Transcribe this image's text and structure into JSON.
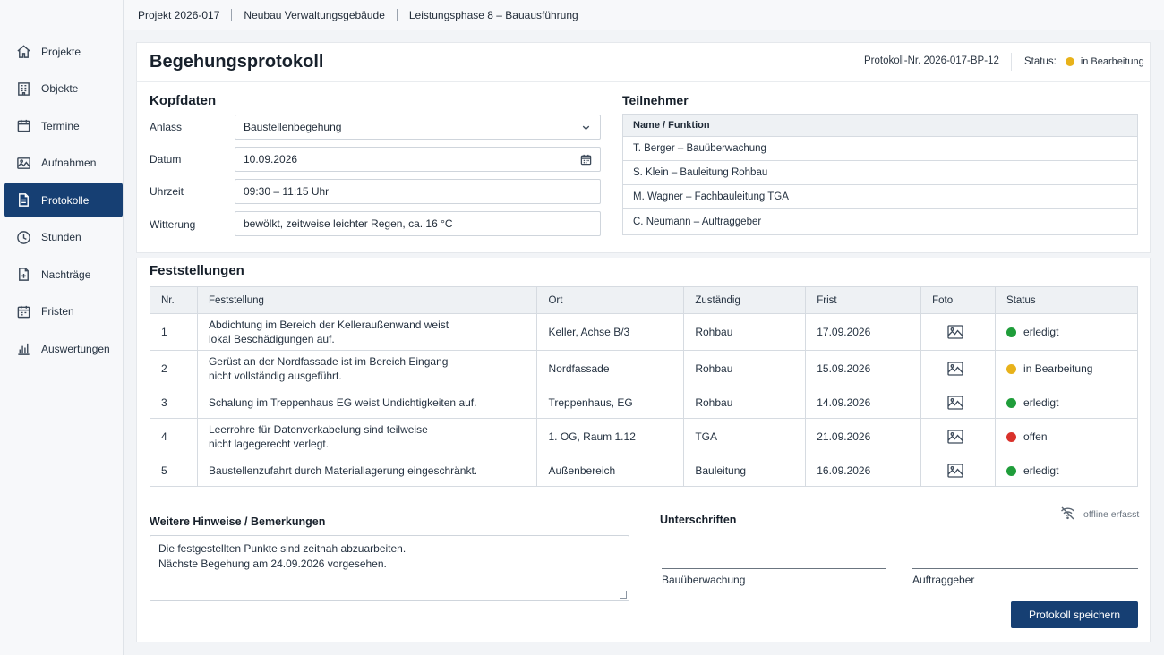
{
  "breadcrumb": [
    "Projekt 2026-017",
    "Neubau Verwaltungsgebäude",
    "Leistungsphase 8 – Bauausführung"
  ],
  "sidebar": {
    "items": [
      {
        "label": "Projekte",
        "icon": "home-icon"
      },
      {
        "label": "Objekte",
        "icon": "building-icon"
      },
      {
        "label": "Termine",
        "icon": "calendar-icon"
      },
      {
        "label": "Aufnahmen",
        "icon": "image-icon"
      },
      {
        "label": "Protokolle",
        "icon": "document-icon",
        "active": true
      },
      {
        "label": "Stunden",
        "icon": "clock-icon"
      },
      {
        "label": "Nachträge",
        "icon": "document-plus-icon"
      },
      {
        "label": "Fristen",
        "icon": "calendar-icon"
      },
      {
        "label": "Auswertungen",
        "icon": "bar-chart-icon"
      }
    ]
  },
  "header": {
    "title": "Begehungsprotokoll",
    "protocol_number": "Protokoll-Nr. 2026-017-BP-12",
    "status_label": "Status:",
    "status_value": "in Bearbeitung",
    "status_color": "#e8b21a"
  },
  "kopfdaten": {
    "title": "Kopfdaten",
    "anlass_label": "Anlass",
    "anlass_value": "Baustellenbegehung",
    "datum_label": "Datum",
    "datum_value": "10.09.2026",
    "uhrzeit_label": "Uhrzeit",
    "uhrzeit_value": "09:30 – 11:15 Uhr",
    "witterung_label": "Witterung",
    "witterung_value": "bewölkt, zeitweise leichter Regen, ca. 16 °C"
  },
  "teilnehmer": {
    "title": "Teilnehmer",
    "column": "Name / Funktion",
    "rows": [
      "T. Berger – Bauüberwachung",
      "S. Klein – Bauleitung Rohbau",
      "M. Wagner – Fachbauleitung TGA",
      "C. Neumann – Auftraggeber"
    ]
  },
  "feststellungen": {
    "title": "Feststellungen",
    "columns": [
      "Nr.",
      "Feststellung",
      "Ort",
      "Zuständig",
      "Frist",
      "Foto",
      "Status"
    ],
    "rows": [
      {
        "nr": "1",
        "text1": "Abdichtung im Bereich der Kelleraußenwand weist",
        "text2": "lokal Beschädigungen auf.",
        "ort": "Keller, Achse B/3",
        "zustaendig": "Rohbau",
        "frist": "17.09.2026",
        "status": "erledigt",
        "color": "#1f9d3a"
      },
      {
        "nr": "2",
        "text1": "Gerüst an der Nordfassade ist im Bereich Eingang",
        "text2": "nicht vollständig ausgeführt.",
        "ort": "Nordfassade",
        "zustaendig": "Rohbau",
        "frist": "15.09.2026",
        "status": "in Bearbeitung",
        "color": "#e8b21a"
      },
      {
        "nr": "3",
        "text1": "Schalung im Treppenhaus EG weist Undichtigkeiten auf.",
        "text2": "",
        "ort": "Treppenhaus, EG",
        "zustaendig": "Rohbau",
        "frist": "14.09.2026",
        "status": "erledigt",
        "color": "#1f9d3a"
      },
      {
        "nr": "4",
        "text1": "Leerrohre für Datenverkabelung sind teilweise",
        "text2": "nicht lagegerecht verlegt.",
        "ort": "1. OG, Raum 1.12",
        "zustaendig": "TGA",
        "frist": "21.09.2026",
        "status": "offen",
        "color": "#d9312b"
      },
      {
        "nr": "5",
        "text1": "Baustellenzufahrt durch Materiallagerung eingeschränkt.",
        "text2": "",
        "ort": "Außenbereich",
        "zustaendig": "Bauleitung",
        "frist": "16.09.2026",
        "status": "erledigt",
        "color": "#1f9d3a"
      }
    ]
  },
  "hinweise": {
    "title": "Weitere Hinweise / Bemerkungen",
    "line1": "Die festgestellten Punkte sind zeitnah abzuarbeiten.",
    "line2": "Nächste Begehung am 24.09.2026 vorgesehen."
  },
  "unterschriften": {
    "title": "Unterschriften",
    "offline": "offline erfasst",
    "sig1": "Bauüberwachung",
    "sig2": "Auftraggeber"
  },
  "save_label": "Protokoll speichern"
}
